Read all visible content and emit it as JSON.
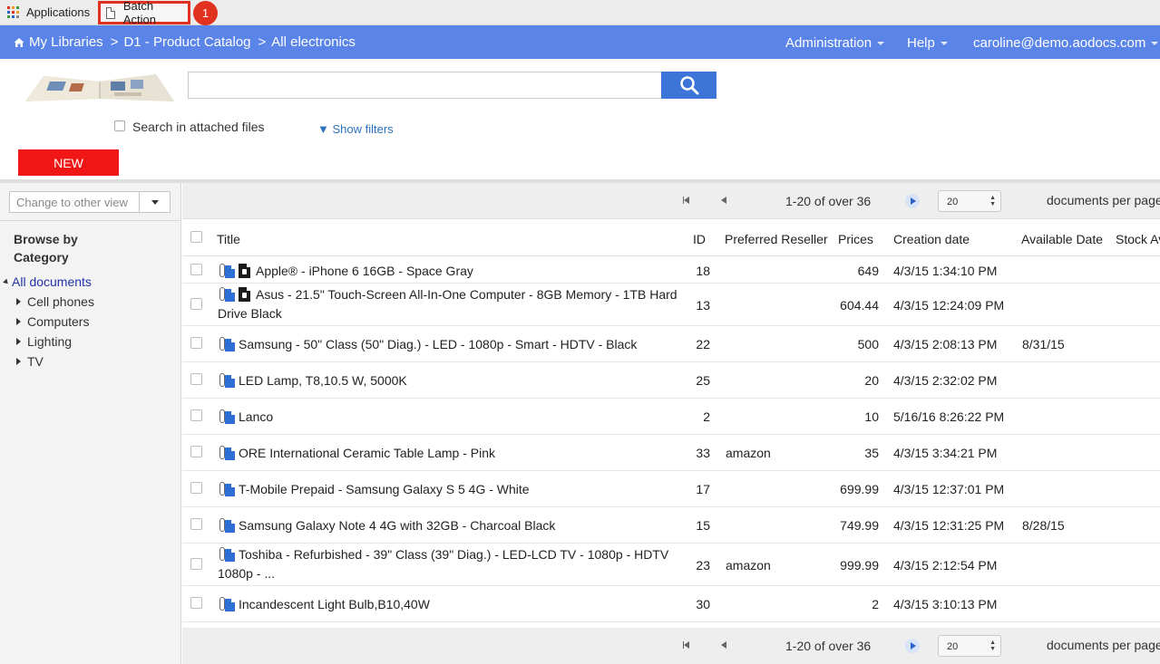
{
  "topbar": {
    "apps_label": "Applications",
    "batch_tab_label": "Batch Action",
    "badge": "1",
    "grid_colors": [
      "#e0321f",
      "#f0a01c",
      "#3c9a3c",
      "#2b62c6",
      "#e0321f",
      "#f0a01c",
      "#3c9a3c",
      "#2b62c6",
      "#8a8a8a"
    ]
  },
  "nav": {
    "crumbs": [
      "My Libraries",
      "D1 - Product Catalog",
      "All electronics"
    ],
    "separator": ">",
    "menu": [
      "Administration",
      "Help",
      "caroline@demo.aodocs.com"
    ],
    "color": "#5a84e8"
  },
  "search": {
    "value": "",
    "attach_label": "Search in attached files",
    "show_filters": "▼ Show filters"
  },
  "new_button": "NEW",
  "sidebar": {
    "view_placeholder": "Change to other view",
    "browse_title": "Browse by Category",
    "root": "All documents",
    "categories": [
      "Cell phones",
      "Computers",
      "Lighting",
      "TV"
    ]
  },
  "pager": {
    "range": "1-20 of over 36",
    "page_size": "20",
    "per_page_label": "documents per page"
  },
  "table": {
    "columns": [
      "Title",
      "ID",
      "Preferred Reseller",
      "Prices",
      "Creation date",
      "Available Date",
      "Stock Av"
    ],
    "rows": [
      {
        "title": "Apple® - iPhone 6 16GB - Space Gray",
        "lock": true,
        "id": "18",
        "reseller": "",
        "price": "649",
        "created": "4/3/15 1:34:10 PM",
        "available": ""
      },
      {
        "title": "Asus - 21.5\" Touch-Screen All-In-One Computer - 8GB Memory - 1TB Hard Drive Black",
        "lock": true,
        "id": "13",
        "reseller": "",
        "price": "604.44",
        "created": "4/3/15 12:24:09 PM",
        "available": ""
      },
      {
        "title": "Samsung - 50\" Class (50\" Diag.) - LED - 1080p - Smart - HDTV - Black",
        "lock": false,
        "id": "22",
        "reseller": "",
        "price": "500",
        "created": "4/3/15 2:08:13 PM",
        "available": "8/31/15"
      },
      {
        "title": "LED Lamp, T8,10.5 W, 5000K",
        "lock": false,
        "id": "25",
        "reseller": "",
        "price": "20",
        "created": "4/3/15 2:32:02 PM",
        "available": ""
      },
      {
        "title": "Lanco",
        "lock": false,
        "id": "2",
        "reseller": "",
        "price": "10",
        "created": "5/16/16 8:26:22 PM",
        "available": ""
      },
      {
        "title": "ORE International Ceramic Table Lamp - Pink",
        "lock": false,
        "id": "33",
        "reseller": "amazon",
        "price": "35",
        "created": "4/3/15 3:34:21 PM",
        "available": ""
      },
      {
        "title": "T-Mobile Prepaid - Samsung Galaxy S 5 4G - White",
        "lock": false,
        "id": "17",
        "reseller": "",
        "price": "699.99",
        "created": "4/3/15 12:37:01 PM",
        "available": ""
      },
      {
        "title": "Samsung Galaxy Note 4 4G with 32GB - Charcoal Black",
        "lock": false,
        "id": "15",
        "reseller": "",
        "price": "749.99",
        "created": "4/3/15 12:31:25 PM",
        "available": "8/28/15"
      },
      {
        "title": "Toshiba - Refurbished - 39\" Class (39\" Diag.) - LED-LCD TV - 1080p - HDTV 1080p - ...",
        "lock": false,
        "id": "23",
        "reseller": "amazon",
        "price": "999.99",
        "created": "4/3/15 2:12:54 PM",
        "available": ""
      },
      {
        "title": "Incandescent Light Bulb,B10,40W",
        "lock": false,
        "id": "30",
        "reseller": "",
        "price": "2",
        "created": "4/3/15 3:10:13 PM",
        "available": ""
      }
    ]
  }
}
